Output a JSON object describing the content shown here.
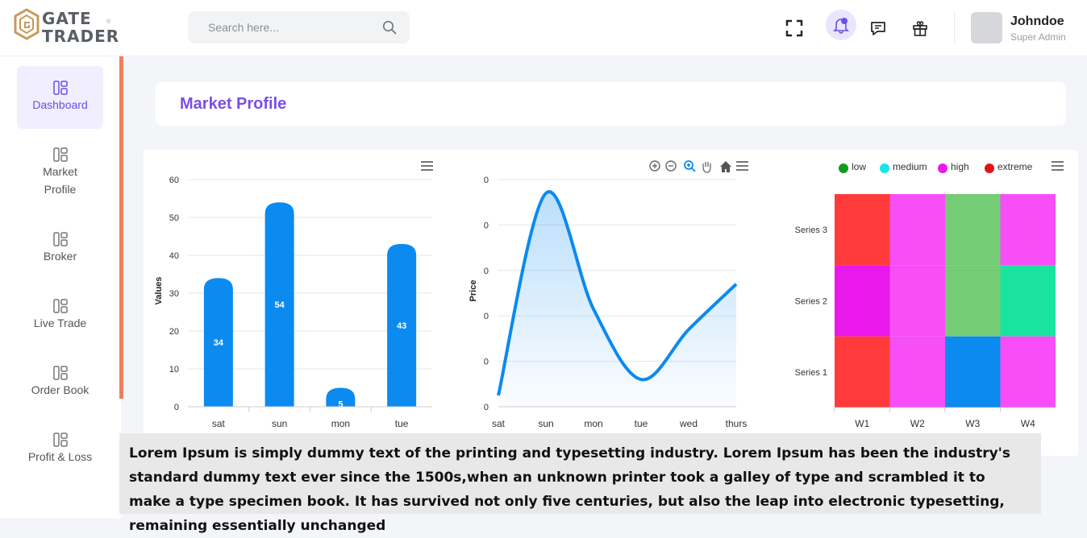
{
  "brand": {
    "name_line1": "GATE",
    "name_line2": "TRADER",
    "registered": "®"
  },
  "search": {
    "placeholder": "Search here..."
  },
  "user": {
    "name": "Johndoe",
    "role": "Super Admin"
  },
  "topbar_icons": [
    "fullscreen-icon",
    "bell-icon",
    "chat-icon",
    "gift-icon"
  ],
  "sidebar": {
    "items": [
      {
        "label": "Dashboard",
        "active": true
      },
      {
        "label": "Market Profile",
        "active": false
      },
      {
        "label": "Broker",
        "active": false
      },
      {
        "label": "Live Trade",
        "active": false
      },
      {
        "label": "Order Book",
        "active": false
      },
      {
        "label": "Profit & Loss",
        "active": false
      }
    ]
  },
  "page": {
    "title": "Market Profile"
  },
  "colors": {
    "accent": "#6c4ee6",
    "bar": "#0b8af0",
    "sidebar_accent": "#f0805a"
  },
  "note": "Lorem Ipsum is simply dummy text of the printing and typesetting industry. Lorem Ipsum has been the industry's standard dummy text ever since the 1500s,when an unknown printer took a galley of type and scrambled it to make a type specimen book. It has survived not only five centuries, but also the leap into electronic typesetting, remaining essentially unchanged",
  "chart_data": [
    {
      "type": "bar",
      "categories": [
        "sat",
        "sun",
        "mon",
        "tue"
      ],
      "values": [
        34,
        54,
        5,
        43
      ],
      "ylabel": "Values",
      "ylim": [
        0,
        60
      ],
      "yticks": [
        "0",
        "10",
        "20",
        "30",
        "40",
        "50",
        "60"
      ],
      "toolbar_icons": [
        "menu-icon"
      ]
    },
    {
      "type": "area",
      "categories": [
        "sat",
        "sun",
        "mon",
        "tue",
        "wed",
        "thurs"
      ],
      "values": [
        0.05,
        0.94,
        0.43,
        0.12,
        0.34,
        0.54
      ],
      "ylabel": "Price",
      "yticks": [
        "0",
        "0",
        "0",
        "0",
        "0",
        "0"
      ],
      "toolbar_icons": [
        "zoom-in-icon",
        "zoom-out-icon",
        "magnify-icon",
        "pan-icon",
        "home-icon",
        "menu-icon"
      ]
    },
    {
      "type": "heatmap",
      "x": [
        "W1",
        "W2",
        "W3",
        "W4"
      ],
      "series": [
        {
          "name": "Series 3",
          "levels": [
            "extreme",
            "high",
            "low",
            "high"
          ]
        },
        {
          "name": "Series 2",
          "levels": [
            "high",
            "high",
            "low",
            "medium"
          ]
        },
        {
          "name": "Series 1",
          "levels": [
            "extreme",
            "high",
            "medium",
            "high"
          ]
        }
      ],
      "legend": [
        {
          "label": "low",
          "color": "#0f9b1b"
        },
        {
          "label": "medium",
          "color": "#15e6e6"
        },
        {
          "label": "high",
          "color": "#ea18ea"
        },
        {
          "label": "extreme",
          "color": "#e21515"
        }
      ],
      "toolbar_icons": [
        "menu-icon"
      ]
    }
  ]
}
